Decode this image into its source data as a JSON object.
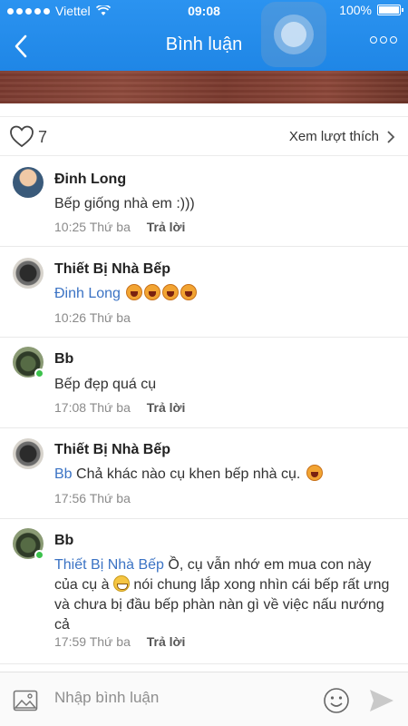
{
  "status_bar": {
    "carrier": "Viettel",
    "time": "09:08",
    "battery": "100%"
  },
  "nav": {
    "title": "Bình luận"
  },
  "likes": {
    "count": "7",
    "see_likes_label": "Xem lượt thích"
  },
  "comments": [
    {
      "name": "Đinh Long",
      "text": "Bếp giống nhà em :)))",
      "time": "10:25",
      "day": "Thứ ba",
      "reply_label": "Trả lời"
    },
    {
      "name": "Thiết Bị Nhà Bếp",
      "mention": "Đinh Long",
      "time": "10:26",
      "day": "Thứ ba"
    },
    {
      "name": "Bb",
      "text": "Bếp đẹp quá cụ",
      "time": "17:08",
      "day": "Thứ ba",
      "reply_label": "Trả lời"
    },
    {
      "name": "Thiết Bị Nhà Bếp",
      "mention": "Bb",
      "text": "Chả khác nào cụ khen bếp nhà cụ.",
      "time": "17:56",
      "day": "Thứ ba"
    },
    {
      "name": "Bb",
      "mention": "Thiết Bị Nhà Bếp",
      "text_before_emoji": "Ồ, cụ vẫn nhớ em mua con này của cụ à",
      "text_after_emoji": "nói chung lắp xong nhìn cái bếp rất ưng và chưa bị đầu bếp phàn nàn gì về việc nấu nướng cả",
      "time": "17:59",
      "day": "Thứ ba",
      "reply_label": "Trả lời"
    }
  ],
  "input": {
    "placeholder": "Nhập bình luận"
  },
  "colors": {
    "header": "#1f86e6",
    "mention": "#3b73c4",
    "online": "#3cc14c"
  },
  "icons": [
    "back-icon",
    "more-icon",
    "heart-icon",
    "chevron-right-icon",
    "image-icon",
    "emoji-icon",
    "send-icon",
    "laughing-emoji-icon",
    "grinning-emoji-icon"
  ]
}
